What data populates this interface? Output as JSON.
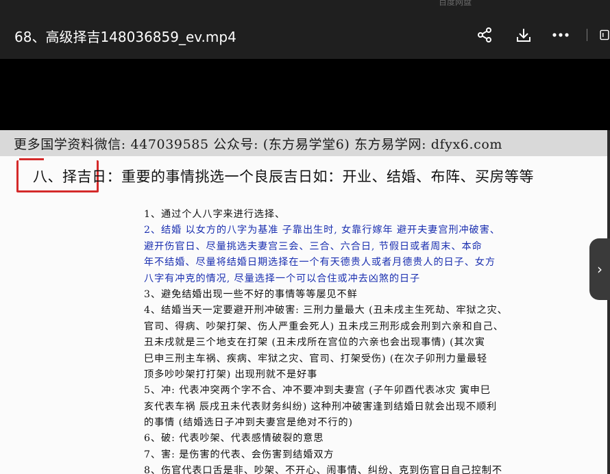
{
  "app": {
    "hint": "百度网盘"
  },
  "header": {
    "title": "68、高级择吉148036859_ev.mp4",
    "icons": [
      "share-icon",
      "download-icon",
      "more-icon",
      "window-icon"
    ]
  },
  "doc": {
    "banner": "更多国学资料微信: 447039585 公众号: (东方易学堂6) 东方易学网: dfyx6.com",
    "heading": "八、择吉日：重要的事情挑选一个良辰吉日如：开业、结婚、布阵、买房等等",
    "lines": [
      {
        "text": "1、通过个人八字来进行选择、",
        "color": "black"
      },
      {
        "text": "2、结婚 以女方的八字为基准 子靠出生时, 女靠行嫁年 避开夫妻宫刑冲破害、",
        "color": "blue"
      },
      {
        "text": "避开伤官日、尽量挑选夫妻宫三会、三合、六合日, 节假日或者周末、本命",
        "color": "blue"
      },
      {
        "text": "年不结婚、尽量将结婚日期选择在一个有天德贵人或者月德贵人的日子、女方",
        "color": "blue"
      },
      {
        "text": "八字有冲克的情况, 尽量选择一个可以合住或冲去凶煞的日子",
        "color": "blue"
      },
      {
        "text": "3、避免结婚出现一些不好的事情等等屡见不鲜",
        "color": "black"
      },
      {
        "text": "4、结婚当天一定要避开刑冲破害: 三刑力量最大 (丑未戌主生死劫、牢狱之灾、",
        "color": "black"
      },
      {
        "text": "官司、得病、吵架打架、伤人严重会死人) 丑未戌三刑形成会刑到六亲和自己、",
        "color": "black"
      },
      {
        "text": "丑未戌就是三个地支在打架 (丑未戌所在宫位的六亲也会出现事情) (其次寅",
        "color": "black"
      },
      {
        "text": "巳申三刑主车祸、疾病、牢狱之灾、官司、打架受伤) (在次子卯刑力量最轻",
        "color": "black"
      },
      {
        "text": "顶多吵吵架打打架) 出现刑就不是好事",
        "color": "black"
      },
      {
        "text": "5、冲: 代表冲突两个字不合、冲不要冲到夫妻宫 (子午卯酉代表冰灾 寅申巳",
        "color": "black"
      },
      {
        "text": "亥代表车祸 辰戌丑未代表财务纠纷) 这种刑冲破害逢到结婚日就会出现不顺利",
        "color": "black"
      },
      {
        "text": "的事情 (结婚选日子冲到夫妻宫是绝对不行的)",
        "color": "black"
      },
      {
        "text": "6、破: 代表吵架、代表感情破裂的意思",
        "color": "black"
      },
      {
        "text": "7、害: 是伤害的代表、会伤害到结婚双方",
        "color": "black"
      },
      {
        "text": "8、伤官代表口舌是非、吵架、不开心、闹事情、纠纷、克到伤官日自己控制不",
        "color": "black"
      }
    ]
  },
  "nav": {
    "next_glyph": "›"
  },
  "colors": {
    "black_text": "#111111",
    "blue_text": "#1a2fb0",
    "red_mark": "#d42a2a"
  }
}
